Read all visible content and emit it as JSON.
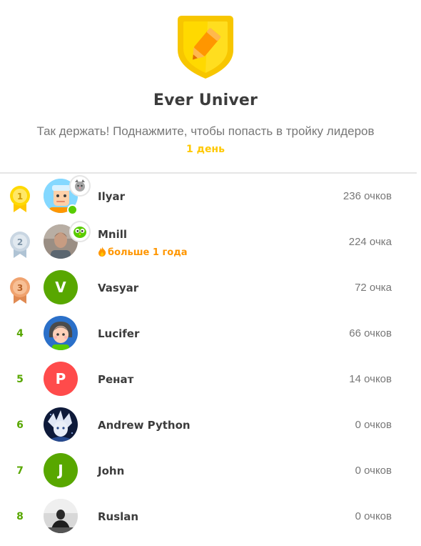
{
  "league": {
    "title": "Ever Univer",
    "subtitle": "Так держать! Поднажмите, чтобы попасть в тройку лидеров",
    "time_left": "1 день",
    "badge_icon": "pencil-league-icon",
    "colors": {
      "gold": "#ffc800",
      "green": "#58a700",
      "streak": "#ff9600"
    }
  },
  "leaderboard": [
    {
      "rank": "1",
      "medal": "gold-medal-icon",
      "name": "Ilyar",
      "points": "236 очков",
      "avatar": "cartoon-boy-avatar",
      "online": true,
      "badge": "cat-badge-icon"
    },
    {
      "rank": "2",
      "medal": "silver-medal-icon",
      "name": "Mnill",
      "points": "224 очка",
      "avatar": "photo-avatar",
      "streak": "больше 1 года",
      "badge": "owl-badge-icon"
    },
    {
      "rank": "3",
      "medal": "bronze-medal-icon",
      "name": "Vasyar",
      "points": "72 очка",
      "avatar_letter": "V",
      "avatar_color": "#58a700"
    },
    {
      "rank": "4",
      "name": "Lucifer",
      "points": "66 очков",
      "avatar": "cartoon-girl-avatar"
    },
    {
      "rank": "5",
      "name": "Ренат",
      "points": "14 очков",
      "avatar_letter": "P",
      "avatar_color": "#ff4b4b"
    },
    {
      "rank": "6",
      "name": "Andrew Python",
      "points": "0 очков",
      "avatar": "anime-avatar"
    },
    {
      "rank": "7",
      "name": "John",
      "points": "0 очков",
      "avatar_letter": "J",
      "avatar_color": "#58a700"
    },
    {
      "rank": "8",
      "name": "Ruslan",
      "points": "0 очков",
      "avatar": "dark-photo-avatar"
    }
  ]
}
